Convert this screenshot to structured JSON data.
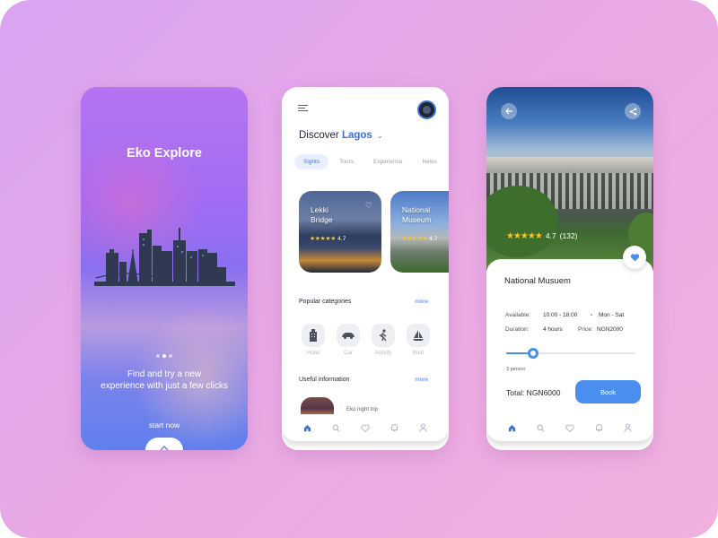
{
  "splash": {
    "app_title": "Eko Explore",
    "tagline_line1": "Find and try a new",
    "tagline_line2": "experience with just a few clicks",
    "start_label": "start now",
    "page_dots": 3,
    "active_dot": 2
  },
  "discover": {
    "heading_prefix": "Discover",
    "heading_city": "Lagos",
    "tabs": [
      {
        "label": "Sights",
        "active": true
      },
      {
        "label": "Tours",
        "active": false
      },
      {
        "label": "Experience",
        "active": false
      },
      {
        "label": "News",
        "active": false
      }
    ],
    "cards": [
      {
        "name_line1": "Lekki",
        "name_line2": "Bridge",
        "rating": "4.7"
      },
      {
        "name_line1": "National",
        "name_line2": "Museum",
        "rating": "4.7"
      }
    ],
    "popular_title": "Popular categories",
    "popular_more": "more",
    "categories": [
      {
        "label": "Hotel",
        "icon": "building-icon"
      },
      {
        "label": "Car",
        "icon": "car-icon"
      },
      {
        "label": "Activity",
        "icon": "walking-icon"
      },
      {
        "label": "Boat",
        "icon": "boat-icon"
      }
    ],
    "useful_title": "Useful information",
    "useful_more": "more",
    "info_item": "Eko night trip"
  },
  "detail": {
    "rating": "4.7",
    "review_count": "(132)",
    "place_name": "National Musuem",
    "available_label": "Available:",
    "available_time": "10:00 - 18:00",
    "available_days": "Mon - Sat",
    "duration_label": "Duration:",
    "duration_value": "4 hours",
    "price_label": "Price:",
    "price_value": "NGN2000",
    "persons": "3 person",
    "slider_fraction": 0.21,
    "total": "Total: NGN6000",
    "book_label": "Book"
  },
  "colors": {
    "accent": "#4a8ef0",
    "city_blue": "#3b6fd8",
    "star": "#f6c624"
  },
  "nav_icons": [
    "home-icon",
    "search-icon",
    "heart-icon",
    "bell-icon",
    "user-icon"
  ]
}
